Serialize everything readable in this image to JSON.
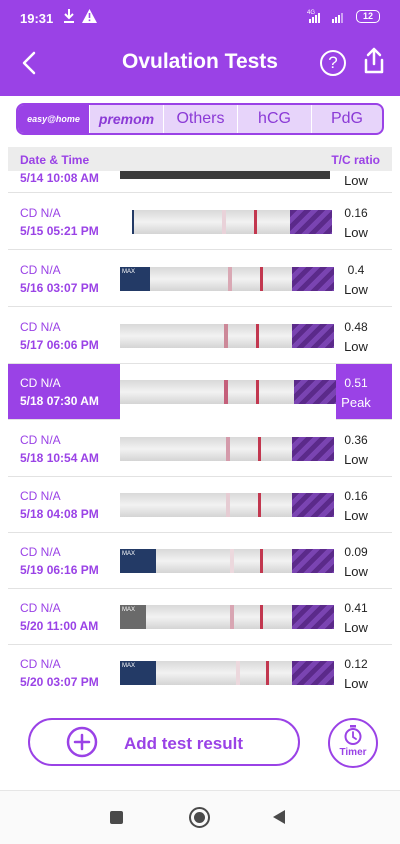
{
  "status": {
    "time": "19:31",
    "network": "4G",
    "battery": "12"
  },
  "header": {
    "title": "Ovulation Tests",
    "help_label": "?"
  },
  "tabs": [
    {
      "label": "easy@home",
      "active": true
    },
    {
      "label": "premom",
      "active": false
    },
    {
      "label": "Others",
      "active": false
    },
    {
      "label": "hCG",
      "active": false
    },
    {
      "label": "PdG",
      "active": false
    }
  ],
  "table_header": {
    "date_time": "Date & Time",
    "ratio": "T/C ratio"
  },
  "rows": [
    {
      "cd": "",
      "datetime": "5/14  10:08 AM",
      "ratio": "",
      "level": "Low"
    },
    {
      "cd": "CD N/A",
      "datetime": "5/15  05:21 PM",
      "ratio": "0.16",
      "level": "Low"
    },
    {
      "cd": "CD N/A",
      "datetime": "5/16  03:07 PM",
      "ratio": "0.4",
      "level": "Low"
    },
    {
      "cd": "CD N/A",
      "datetime": "5/17  06:06 PM",
      "ratio": "0.48",
      "level": "Low"
    },
    {
      "cd": "CD N/A",
      "datetime": "5/18  07:30 AM",
      "ratio": "0.51",
      "level": "Peak"
    },
    {
      "cd": "CD N/A",
      "datetime": "5/18  10:54 AM",
      "ratio": "0.36",
      "level": "Low"
    },
    {
      "cd": "CD N/A",
      "datetime": "5/18  04:08 PM",
      "ratio": "0.16",
      "level": "Low"
    },
    {
      "cd": "CD N/A",
      "datetime": "5/19  06:16 PM",
      "ratio": "0.09",
      "level": "Low"
    },
    {
      "cd": "CD N/A",
      "datetime": "5/20  11:00 AM",
      "ratio": "0.41",
      "level": "Low"
    },
    {
      "cd": "CD N/A",
      "datetime": "5/20  03:07 PM",
      "ratio": "0.12",
      "level": "Low"
    }
  ],
  "strip_label": "MAX",
  "actions": {
    "add_label": "Add test result",
    "timer_label": "Timer"
  },
  "colors": {
    "accent": "#9a42e6",
    "control_line": "#c2374f"
  }
}
